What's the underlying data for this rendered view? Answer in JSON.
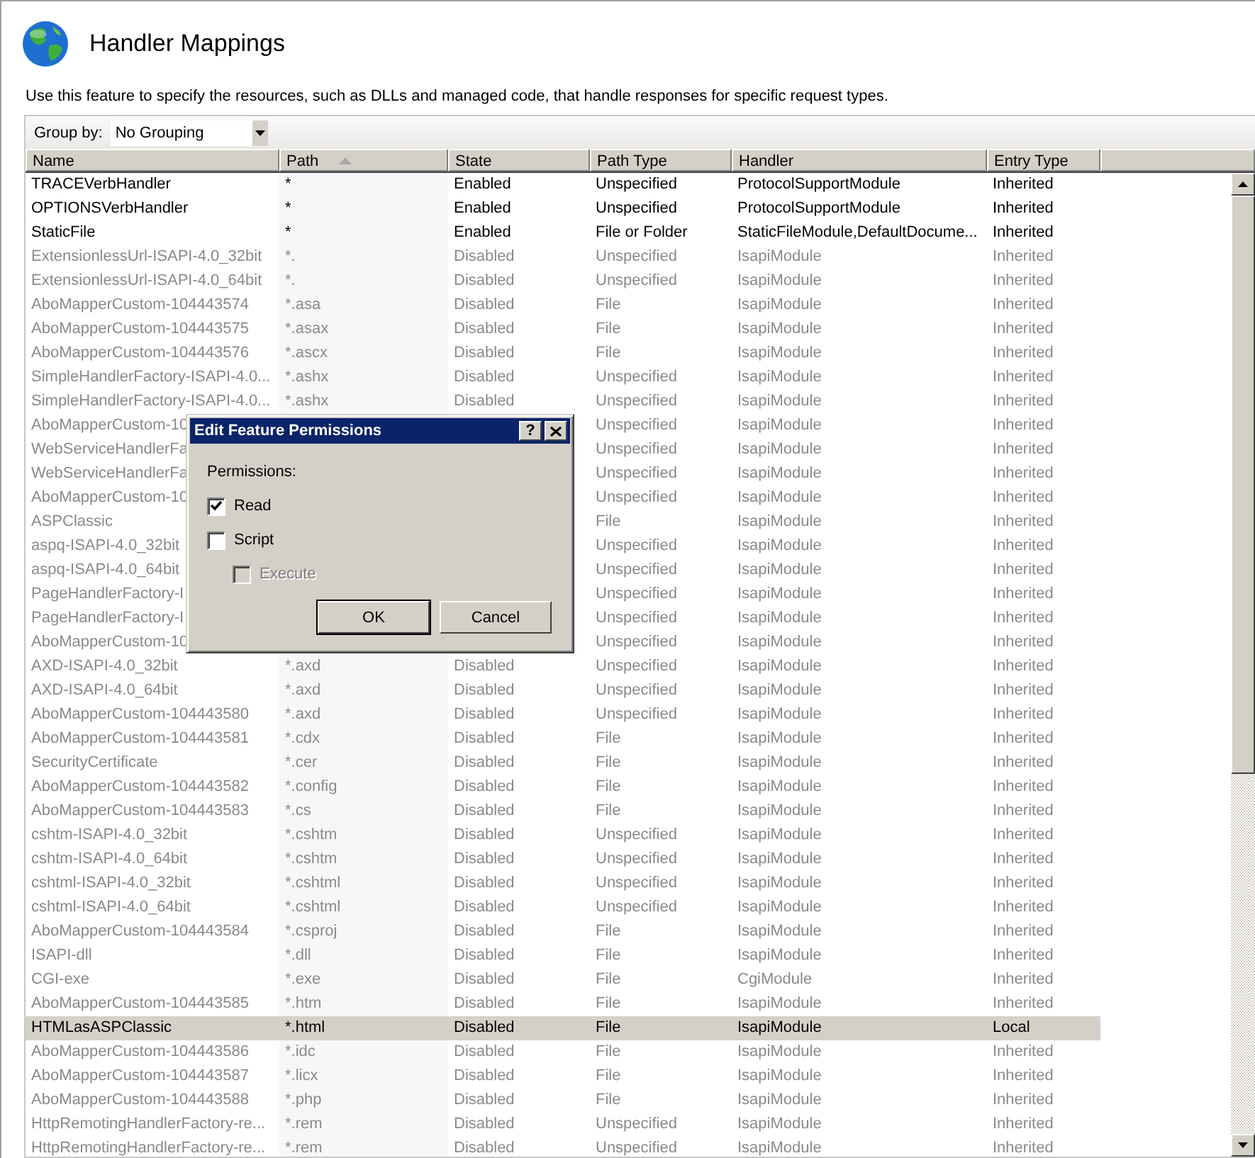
{
  "page": {
    "title": "Handler Mappings",
    "description": "Use this feature to specify the resources, such as DLLs and managed code, that handle responses for specific request types."
  },
  "toolbar": {
    "group_by_label": "Group by:",
    "group_by_value": "No Grouping"
  },
  "table": {
    "columns": [
      {
        "label": "Name",
        "sorted": false
      },
      {
        "label": "Path",
        "sorted": true
      },
      {
        "label": "State",
        "sorted": false
      },
      {
        "label": "Path Type",
        "sorted": false
      },
      {
        "label": "Handler",
        "sorted": false
      },
      {
        "label": "Entry Type",
        "sorted": false
      }
    ],
    "rows": [
      {
        "name": "TRACEVerbHandler",
        "path": "*",
        "state": "Enabled",
        "path_type": "Unspecified",
        "handler": "ProtocolSupportModule",
        "entry_type": "Inherited",
        "disabled": false,
        "selected": false
      },
      {
        "name": "OPTIONSVerbHandler",
        "path": "*",
        "state": "Enabled",
        "path_type": "Unspecified",
        "handler": "ProtocolSupportModule",
        "entry_type": "Inherited",
        "disabled": false,
        "selected": false
      },
      {
        "name": "StaticFile",
        "path": "*",
        "state": "Enabled",
        "path_type": "File or Folder",
        "handler": "StaticFileModule,DefaultDocume...",
        "entry_type": "Inherited",
        "disabled": false,
        "selected": false
      },
      {
        "name": "ExtensionlessUrl-ISAPI-4.0_32bit",
        "path": "*.",
        "state": "Disabled",
        "path_type": "Unspecified",
        "handler": "IsapiModule",
        "entry_type": "Inherited",
        "disabled": true,
        "selected": false
      },
      {
        "name": "ExtensionlessUrl-ISAPI-4.0_64bit",
        "path": "*.",
        "state": "Disabled",
        "path_type": "Unspecified",
        "handler": "IsapiModule",
        "entry_type": "Inherited",
        "disabled": true,
        "selected": false
      },
      {
        "name": "AboMapperCustom-104443574",
        "path": "*.asa",
        "state": "Disabled",
        "path_type": "File",
        "handler": "IsapiModule",
        "entry_type": "Inherited",
        "disabled": true,
        "selected": false
      },
      {
        "name": "AboMapperCustom-104443575",
        "path": "*.asax",
        "state": "Disabled",
        "path_type": "File",
        "handler": "IsapiModule",
        "entry_type": "Inherited",
        "disabled": true,
        "selected": false
      },
      {
        "name": "AboMapperCustom-104443576",
        "path": "*.ascx",
        "state": "Disabled",
        "path_type": "File",
        "handler": "IsapiModule",
        "entry_type": "Inherited",
        "disabled": true,
        "selected": false
      },
      {
        "name": "SimpleHandlerFactory-ISAPI-4.0...",
        "path": "*.ashx",
        "state": "Disabled",
        "path_type": "Unspecified",
        "handler": "IsapiModule",
        "entry_type": "Inherited",
        "disabled": true,
        "selected": false
      },
      {
        "name": "SimpleHandlerFactory-ISAPI-4.0...",
        "path": "*.ashx",
        "state": "Disabled",
        "path_type": "Unspecified",
        "handler": "IsapiModule",
        "entry_type": "Inherited",
        "disabled": true,
        "selected": false
      },
      {
        "name": "AboMapperCustom-10",
        "path_type": "Unspecified",
        "handler": "IsapiModule",
        "entry_type": "Inherited",
        "disabled": true,
        "selected": false
      },
      {
        "name": "WebServiceHandlerFa",
        "path_type": "Unspecified",
        "handler": "IsapiModule",
        "entry_type": "Inherited",
        "disabled": true,
        "selected": false
      },
      {
        "name": "WebServiceHandlerFa",
        "path_type": "Unspecified",
        "handler": "IsapiModule",
        "entry_type": "Inherited",
        "disabled": true,
        "selected": false
      },
      {
        "name": "AboMapperCustom-10",
        "path_type": "Unspecified",
        "handler": "IsapiModule",
        "entry_type": "Inherited",
        "disabled": true,
        "selected": false
      },
      {
        "name": "ASPClassic",
        "path_type": "File",
        "handler": "IsapiModule",
        "entry_type": "Inherited",
        "disabled": true,
        "selected": false
      },
      {
        "name": "aspq-ISAPI-4.0_32bit",
        "path_type": "Unspecified",
        "handler": "IsapiModule",
        "entry_type": "Inherited",
        "disabled": true,
        "selected": false
      },
      {
        "name": "aspq-ISAPI-4.0_64bit",
        "path_type": "Unspecified",
        "handler": "IsapiModule",
        "entry_type": "Inherited",
        "disabled": true,
        "selected": false
      },
      {
        "name": "PageHandlerFactory-I",
        "path_type": "Unspecified",
        "handler": "IsapiModule",
        "entry_type": "Inherited",
        "disabled": true,
        "selected": false
      },
      {
        "name": "PageHandlerFactory-I",
        "path_type": "Unspecified",
        "handler": "IsapiModule",
        "entry_type": "Inherited",
        "disabled": true,
        "selected": false
      },
      {
        "name": "AboMapperCustom-10",
        "path_type": "Unspecified",
        "handler": "IsapiModule",
        "entry_type": "Inherited",
        "disabled": true,
        "selected": false
      },
      {
        "name": "AXD-ISAPI-4.0_32bit",
        "path": "*.axd",
        "state": "Disabled",
        "path_type": "Unspecified",
        "handler": "IsapiModule",
        "entry_type": "Inherited",
        "disabled": true,
        "selected": false
      },
      {
        "name": "AXD-ISAPI-4.0_64bit",
        "path": "*.axd",
        "state": "Disabled",
        "path_type": "Unspecified",
        "handler": "IsapiModule",
        "entry_type": "Inherited",
        "disabled": true,
        "selected": false
      },
      {
        "name": "AboMapperCustom-104443580",
        "path": "*.axd",
        "state": "Disabled",
        "path_type": "Unspecified",
        "handler": "IsapiModule",
        "entry_type": "Inherited",
        "disabled": true,
        "selected": false
      },
      {
        "name": "AboMapperCustom-104443581",
        "path": "*.cdx",
        "state": "Disabled",
        "path_type": "File",
        "handler": "IsapiModule",
        "entry_type": "Inherited",
        "disabled": true,
        "selected": false
      },
      {
        "name": "SecurityCertificate",
        "path": "*.cer",
        "state": "Disabled",
        "path_type": "File",
        "handler": "IsapiModule",
        "entry_type": "Inherited",
        "disabled": true,
        "selected": false
      },
      {
        "name": "AboMapperCustom-104443582",
        "path": "*.config",
        "state": "Disabled",
        "path_type": "File",
        "handler": "IsapiModule",
        "entry_type": "Inherited",
        "disabled": true,
        "selected": false
      },
      {
        "name": "AboMapperCustom-104443583",
        "path": "*.cs",
        "state": "Disabled",
        "path_type": "File",
        "handler": "IsapiModule",
        "entry_type": "Inherited",
        "disabled": true,
        "selected": false
      },
      {
        "name": "cshtm-ISAPI-4.0_32bit",
        "path": "*.cshtm",
        "state": "Disabled",
        "path_type": "Unspecified",
        "handler": "IsapiModule",
        "entry_type": "Inherited",
        "disabled": true,
        "selected": false
      },
      {
        "name": "cshtm-ISAPI-4.0_64bit",
        "path": "*.cshtm",
        "state": "Disabled",
        "path_type": "Unspecified",
        "handler": "IsapiModule",
        "entry_type": "Inherited",
        "disabled": true,
        "selected": false
      },
      {
        "name": "cshtml-ISAPI-4.0_32bit",
        "path": "*.cshtml",
        "state": "Disabled",
        "path_type": "Unspecified",
        "handler": "IsapiModule",
        "entry_type": "Inherited",
        "disabled": true,
        "selected": false
      },
      {
        "name": "cshtml-ISAPI-4.0_64bit",
        "path": "*.cshtml",
        "state": "Disabled",
        "path_type": "Unspecified",
        "handler": "IsapiModule",
        "entry_type": "Inherited",
        "disabled": true,
        "selected": false
      },
      {
        "name": "AboMapperCustom-104443584",
        "path": "*.csproj",
        "state": "Disabled",
        "path_type": "File",
        "handler": "IsapiModule",
        "entry_type": "Inherited",
        "disabled": true,
        "selected": false
      },
      {
        "name": "ISAPI-dll",
        "path": "*.dll",
        "state": "Disabled",
        "path_type": "File",
        "handler": "IsapiModule",
        "entry_type": "Inherited",
        "disabled": true,
        "selected": false
      },
      {
        "name": "CGI-exe",
        "path": "*.exe",
        "state": "Disabled",
        "path_type": "File",
        "handler": "CgiModule",
        "entry_type": "Inherited",
        "disabled": true,
        "selected": false
      },
      {
        "name": "AboMapperCustom-104443585",
        "path": "*.htm",
        "state": "Disabled",
        "path_type": "File",
        "handler": "IsapiModule",
        "entry_type": "Inherited",
        "disabled": true,
        "selected": false
      },
      {
        "name": "HTMLasASPClassic",
        "path": "*.html",
        "state": "Disabled",
        "path_type": "File",
        "handler": "IsapiModule",
        "entry_type": "Local",
        "disabled": false,
        "selected": true
      },
      {
        "name": "AboMapperCustom-104443586",
        "path": "*.idc",
        "state": "Disabled",
        "path_type": "File",
        "handler": "IsapiModule",
        "entry_type": "Inherited",
        "disabled": true,
        "selected": false
      },
      {
        "name": "AboMapperCustom-104443587",
        "path": "*.licx",
        "state": "Disabled",
        "path_type": "File",
        "handler": "IsapiModule",
        "entry_type": "Inherited",
        "disabled": true,
        "selected": false
      },
      {
        "name": "AboMapperCustom-104443588",
        "path": "*.php",
        "state": "Disabled",
        "path_type": "File",
        "handler": "IsapiModule",
        "entry_type": "Inherited",
        "disabled": true,
        "selected": false
      },
      {
        "name": "HttpRemotingHandlerFactory-re...",
        "path": "*.rem",
        "state": "Disabled",
        "path_type": "Unspecified",
        "handler": "IsapiModule",
        "entry_type": "Inherited",
        "disabled": true,
        "selected": false
      },
      {
        "name": "HttpRemotingHandlerFactory-re...",
        "path": "*.rem",
        "state": "Disabled",
        "path_type": "Unspecified",
        "handler": "IsapiModule",
        "entry_type": "Inherited",
        "disabled": true,
        "selected": false
      }
    ]
  },
  "dialog": {
    "title": "Edit Feature Permissions",
    "help_button": "?",
    "label": "Permissions:",
    "options": [
      {
        "label": "Read",
        "checked": true,
        "disabled": false
      },
      {
        "label": "Script",
        "checked": false,
        "disabled": false,
        "children": [
          {
            "label": "Execute",
            "checked": false,
            "disabled": true
          }
        ]
      }
    ],
    "buttons": [
      {
        "label": "OK",
        "default": true
      },
      {
        "label": "Cancel",
        "default": false
      }
    ]
  }
}
